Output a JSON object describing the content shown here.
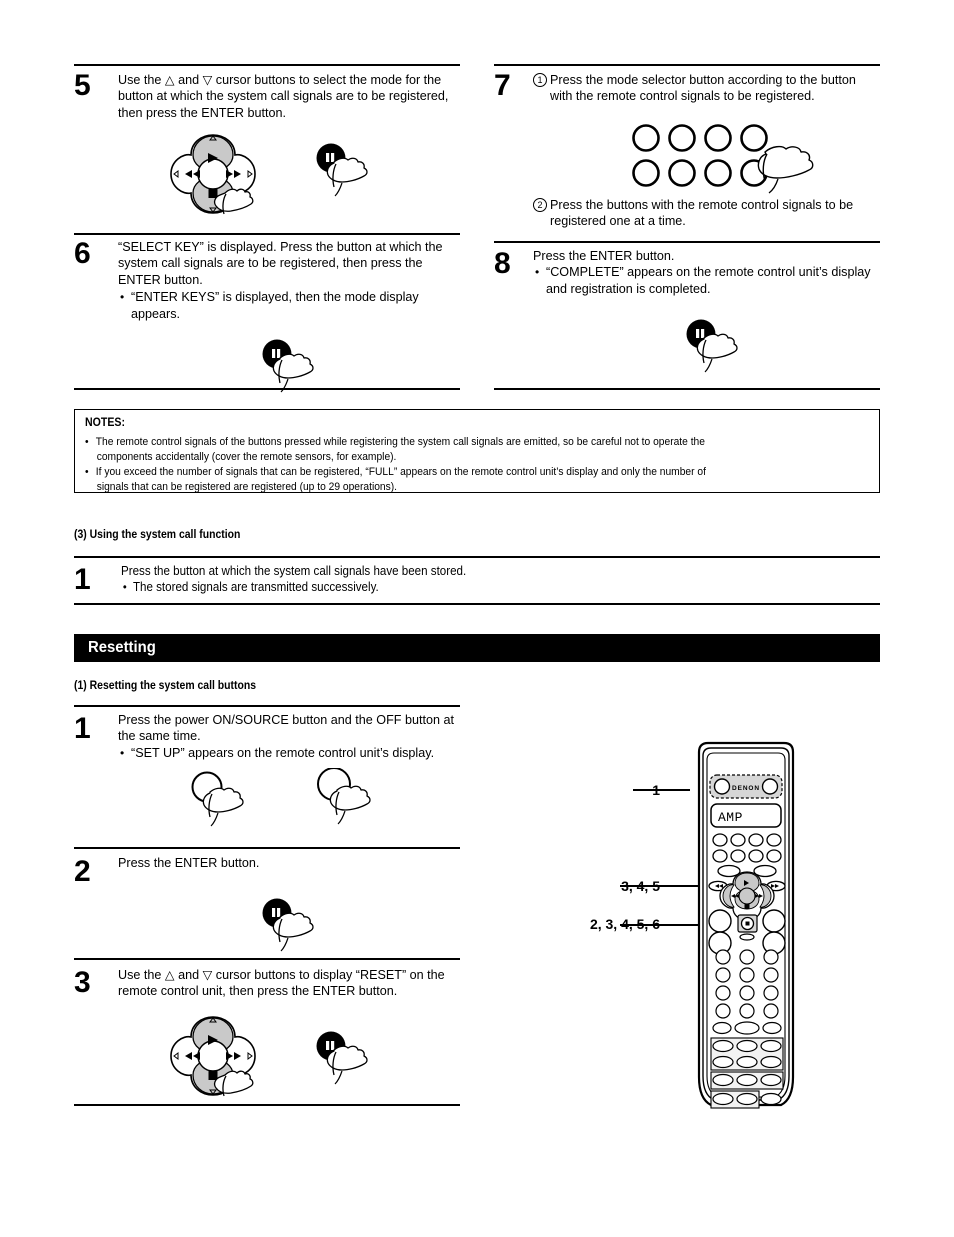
{
  "document": {
    "page_type": "instruction-manual-page"
  },
  "steps": {
    "step5": {
      "number": "5",
      "line1": "Use the △ and ▽ cursor buttons to select the mode for the",
      "line2": "button at which the system call signals are to be registered,",
      "line3": "then press the ENTER button."
    },
    "step6": {
      "number": "6",
      "line1": "“SELECT KEY” is displayed. Press the button at which the",
      "line2": "system call signals are to be registered, then press the",
      "line3": "ENTER button.",
      "bullet1_l1": "“ENTER KEYS” is displayed, then the mode display",
      "bullet1_l2": "appears."
    },
    "step7": {
      "number": "7",
      "item1_marker": "1",
      "item1_l1": "Press the mode selector button according to the button",
      "item1_l2": "with the remote control signals to be registered.",
      "item2_marker": "2",
      "item2_l1": "Press the buttons with the remote control signals to be",
      "item2_l2": "registered one at a time."
    },
    "step8": {
      "number": "8",
      "line1": "Press the ENTER button.",
      "bullet1_l1": "“COMPLETE” appears on the remote control unit’s display",
      "bullet1_l2": "and registration is completed."
    }
  },
  "notes": {
    "title": "NOTES:",
    "items": [
      {
        "line1": "The remote control signals of the buttons pressed while registering the system call signals are emitted, so be careful not to operate the",
        "line2": "components accidentally (cover the remote sensors, for example)."
      },
      {
        "line1": "If you exceed the number of signals that can be registered, “FULL” appears on the remote control unit’s display and only the number of",
        "line2": "signals that can be registered are registered (up to 29 operations)."
      }
    ]
  },
  "section_using": {
    "heading": "(3) Using the system call function",
    "step1": {
      "number": "1",
      "line1": "Press the button at which the system call signals have been stored.",
      "bullet1": "The stored signals are transmitted successively."
    }
  },
  "section_resetting": {
    "bar_label": "Resetting",
    "heading": "(1) Resetting the system call buttons",
    "step1": {
      "number": "1",
      "line1": "Press the power ON/SOURCE button and the OFF button at",
      "line2": "the same time.",
      "bullet1": "“SET UP” appears on the remote control unit’s display."
    },
    "step2": {
      "number": "2",
      "line1": "Press the ENTER button."
    },
    "step3": {
      "number": "3",
      "line1": "Use the △ and ▽ cursor buttons to display “RESET” on the",
      "line2": "remote control unit, then press the ENTER button."
    }
  },
  "remote": {
    "brand": "DENON",
    "display_text": "AMP",
    "callouts": [
      {
        "label": "1"
      },
      {
        "label": "3, 4, 5"
      },
      {
        "label": "2, 3, 4, 5, 6"
      }
    ]
  },
  "colors": {
    "ink": "#000000",
    "paper": "#ffffff",
    "shade": "#c9c9c9",
    "panel_shade": "#d6d6d6"
  }
}
